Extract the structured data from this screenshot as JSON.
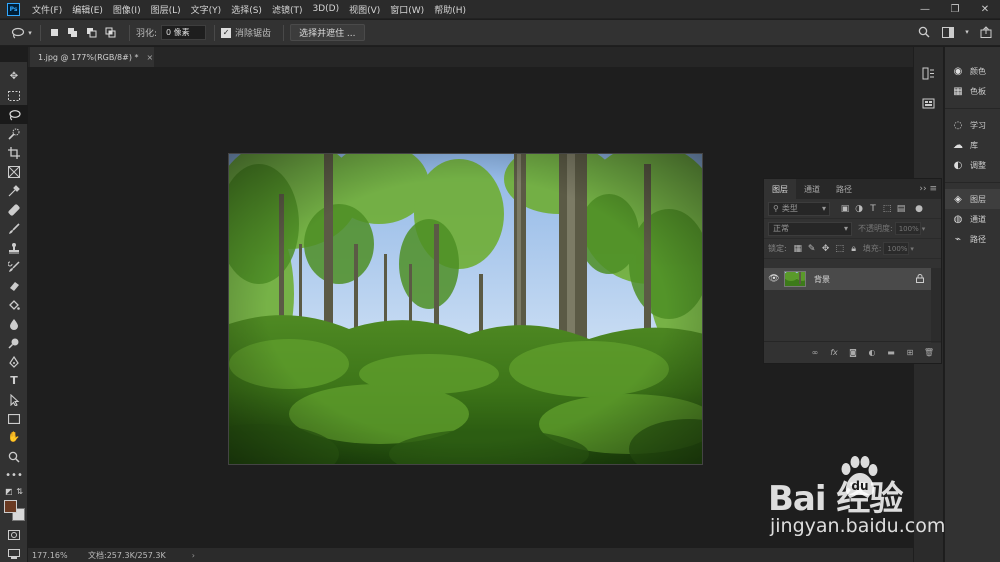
{
  "menubar": {
    "logo": "Ps",
    "items": [
      "文件(F)",
      "编辑(E)",
      "图像(I)",
      "图层(L)",
      "文字(Y)",
      "选择(S)",
      "滤镜(T)",
      "3D(D)",
      "视图(V)",
      "窗口(W)",
      "帮助(H)"
    ],
    "window_controls": [
      "—",
      "❐",
      "✕"
    ]
  },
  "options": {
    "feather_label": "羽化:",
    "feather_value": "0 像素",
    "antialias_label": "消除锯齿",
    "select_mask_button": "选择并遮住 ..."
  },
  "tab": {
    "title": "1.jpg @ 177%(RGB/8#) *",
    "close": "×"
  },
  "status": {
    "zoom": "177.16%",
    "doc_info": "文档:257.3K/257.3K",
    "arrow": "›"
  },
  "dock": {
    "items": [
      {
        "icon": "palette-icon",
        "glyph": "◉",
        "label": "颜色"
      },
      {
        "icon": "swatches-icon",
        "glyph": "▦",
        "label": "色板"
      },
      {
        "icon": "learn-icon",
        "glyph": "◌",
        "label": "学习"
      },
      {
        "icon": "libraries-icon",
        "glyph": "☁",
        "label": "库"
      },
      {
        "icon": "adjustments-icon",
        "glyph": "◐",
        "label": "调整"
      },
      {
        "icon": "layers-icon",
        "glyph": "◈",
        "label": "图层"
      },
      {
        "icon": "channels-icon",
        "glyph": "◍",
        "label": "通道"
      },
      {
        "icon": "paths-icon",
        "glyph": "⌁",
        "label": "路径"
      }
    ]
  },
  "layers": {
    "tabs": [
      "图层",
      "通道",
      "路径"
    ],
    "more": "›› ≡",
    "kind_label": "类型",
    "blend_mode": "正常",
    "opacity_label": "不透明度:",
    "opacity_value": "100%",
    "lock_label": "锁定:",
    "fill_label": "填充:",
    "fill_value": "100%",
    "layer_name": "背景"
  },
  "watermark": {
    "logo_text": "Bai  经验",
    "url": "jingyan.baidu.com"
  },
  "colors": {
    "foreground": "#6b3a22",
    "background": "#d8d8d8",
    "accent": "#31a8ff"
  }
}
